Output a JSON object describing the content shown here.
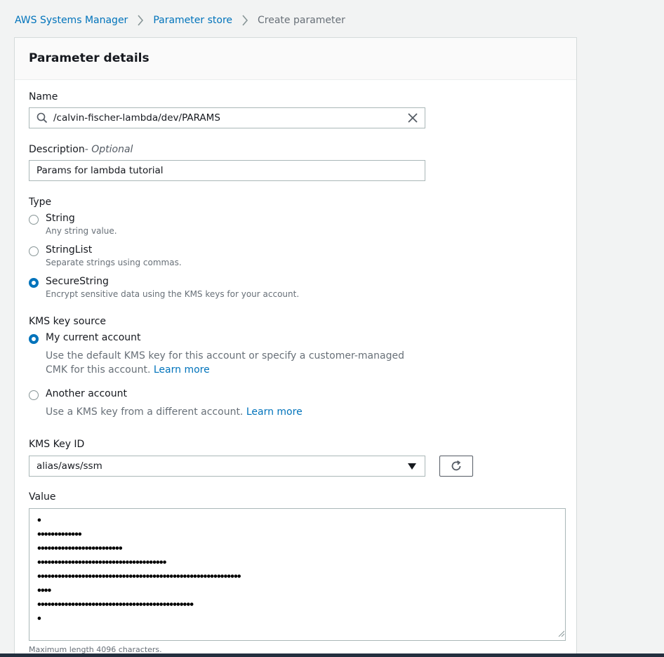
{
  "breadcrumb": {
    "items": [
      "AWS Systems Manager",
      "Parameter store",
      "Create parameter"
    ]
  },
  "panel": {
    "title": "Parameter details"
  },
  "name_field": {
    "label": "Name",
    "value": "/calvin-fischer-lambda/dev/PARAMS"
  },
  "description_field": {
    "label": "Description",
    "optional": "- Optional",
    "value": "Params for lambda tutorial"
  },
  "type": {
    "label": "Type",
    "options": [
      {
        "label": "String",
        "desc": "Any string value.",
        "checked": false
      },
      {
        "label": "StringList",
        "desc": "Separate strings using commas.",
        "checked": false
      },
      {
        "label": "SecureString",
        "desc": "Encrypt sensitive data using the KMS keys for your account.",
        "checked": true
      }
    ]
  },
  "kms_source": {
    "label": "KMS key source",
    "options": [
      {
        "label": "My current account",
        "desc": "Use the default KMS key for this account or specify a customer-managed CMK for this account.",
        "link": "Learn more",
        "checked": true
      },
      {
        "label": "Another account",
        "desc": "Use a KMS key from a different account.",
        "link": "Learn more",
        "checked": false
      }
    ]
  },
  "kms_key_id": {
    "label": "KMS Key ID",
    "value": "alias/aws/ssm"
  },
  "value_field": {
    "label": "Value",
    "lines": [
      "•",
      "•••••••••••••",
      "•••••••••••••••••••••••••",
      "••••••••••••••••••••••••••••••••••••••",
      "••••••••••••••••••••••••••••••••••••••••••••••••••••••••••••",
      "••••",
      "••••••••••••••••••••••••••••••••••••••••••••••",
      "•"
    ],
    "hint": "Maximum length 4096 characters."
  },
  "colors": {
    "link": "#0073bb",
    "radio_checked": "#0073bb",
    "panel_header_bg": "#fafafa",
    "page_bg": "#f2f3f3"
  },
  "icons": [
    "chevron-right-icon",
    "search-icon",
    "close-icon",
    "caret-down-icon",
    "refresh-icon",
    "resize-grip-icon"
  ]
}
